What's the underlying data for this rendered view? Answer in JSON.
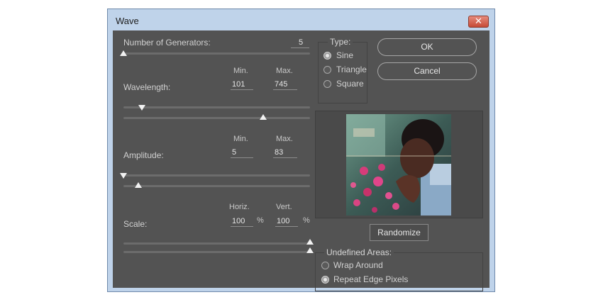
{
  "window": {
    "title": "Wave",
    "close_glyph": "✕"
  },
  "generators": {
    "label": "Number of Generators:",
    "value": "5"
  },
  "wavelength": {
    "label": "Wavelength:",
    "min_label": "Min.",
    "max_label": "Max.",
    "min": "101",
    "max": "745"
  },
  "amplitude": {
    "label": "Amplitude:",
    "min_label": "Min.",
    "max_label": "Max.",
    "min": "5",
    "max": "83"
  },
  "scale": {
    "label": "Scale:",
    "horiz_label": "Horiz.",
    "vert_label": "Vert.",
    "horiz": "100",
    "vert": "100",
    "unit": "%"
  },
  "type": {
    "title": "Type:",
    "options": [
      "Sine",
      "Triangle",
      "Square"
    ],
    "selected": "Sine"
  },
  "buttons": {
    "ok": "OK",
    "cancel": "Cancel",
    "randomize": "Randomize"
  },
  "undefined_areas": {
    "title": "Undefined Areas:",
    "options": [
      "Wrap Around",
      "Repeat Edge Pixels"
    ],
    "selected": "Repeat Edge Pixels"
  },
  "sliders": {
    "generators": 0.0,
    "wavelength_min": 0.1,
    "wavelength_max": 0.75,
    "amplitude_min": 0.0,
    "amplitude_max": 0.08,
    "scale_horiz": 1.0,
    "scale_vert": 1.0
  },
  "colors": {
    "panel": "#535353",
    "titlebar": "#bfd3ea",
    "close": "#c64a36"
  }
}
